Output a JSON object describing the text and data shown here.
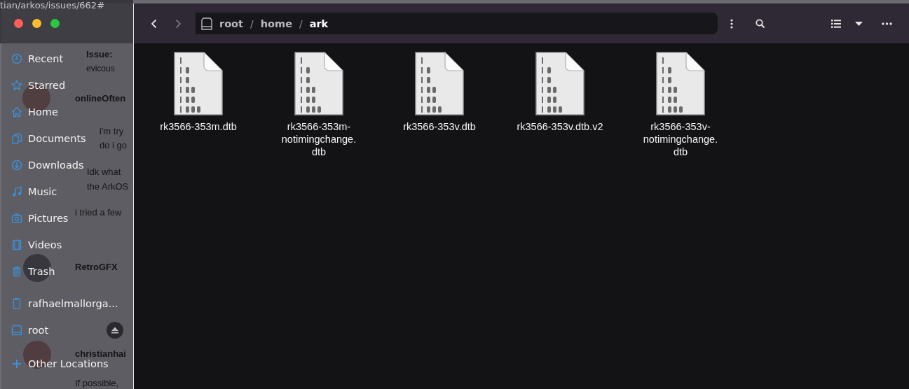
{
  "background_browser": {
    "address": "tian/arkos/issues/662#",
    "fragments": [
      {
        "kind": "title",
        "text": "Issue:"
      },
      {
        "kind": "meta",
        "text": "evicous"
      },
      {
        "kind": "author",
        "text": "onlineOften"
      },
      {
        "kind": "quote",
        "text": "i'm try"
      },
      {
        "kind": "quote",
        "text": "do i go"
      },
      {
        "kind": "body",
        "text": "Idk what"
      },
      {
        "kind": "body",
        "text": "the ArkOS"
      },
      {
        "kind": "body",
        "text": "i tried a few"
      },
      {
        "kind": "author",
        "text": "RetroGFX"
      },
      {
        "kind": "author",
        "text": "christianhai"
      },
      {
        "kind": "body",
        "text": "If possible,"
      }
    ]
  },
  "sidebar": {
    "items": [
      {
        "label": "Recent",
        "kind": "clock",
        "ejectable": false
      },
      {
        "label": "Starred",
        "kind": "star",
        "ejectable": false
      },
      {
        "label": "Home",
        "kind": "home",
        "ejectable": false
      },
      {
        "label": "Documents",
        "kind": "documents",
        "ejectable": false
      },
      {
        "label": "Downloads",
        "kind": "download",
        "ejectable": false
      },
      {
        "label": "Music",
        "kind": "music",
        "ejectable": false
      },
      {
        "label": "Pictures",
        "kind": "camera",
        "ejectable": false
      },
      {
        "label": "Videos",
        "kind": "film",
        "ejectable": false
      },
      {
        "label": "Trash",
        "kind": "trash",
        "ejectable": false
      },
      {
        "label": "rafhaelmallorga...",
        "kind": "phone",
        "ejectable": false
      },
      {
        "label": "root",
        "kind": "drive",
        "ejectable": true
      },
      {
        "label": "Other Locations",
        "kind": "plus",
        "ejectable": false
      }
    ]
  },
  "toolbar": {
    "back": {
      "disabled": false
    },
    "forward": {
      "disabled": true
    },
    "path_bar": {
      "separator": "/",
      "segments": [
        {
          "label": "root",
          "current": false
        },
        {
          "label": "home",
          "current": false
        },
        {
          "label": "ark",
          "current": true
        }
      ]
    }
  },
  "files": [
    {
      "name": "rk3566-353m.dtb"
    },
    {
      "name": "rk3566-353m-notimingchange.dtb"
    },
    {
      "name": "rk3566-353v.dtb"
    },
    {
      "name": "rk3566-353v.dtb.v2"
    },
    {
      "name": "rk3566-353v-notimingchange.dtb"
    }
  ]
}
